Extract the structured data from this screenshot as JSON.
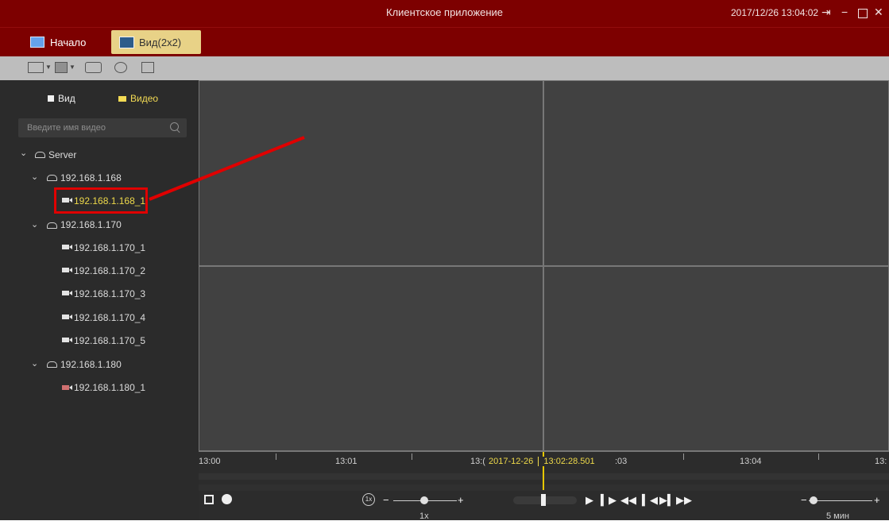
{
  "window": {
    "title": "Клиентское приложение",
    "clock": "2017/12/26 13:04:02"
  },
  "tabs": [
    {
      "label": "Начало",
      "active": false
    },
    {
      "label": "Вид(2x2)",
      "active": true
    }
  ],
  "sidebar": {
    "tabs": [
      {
        "label": "Вид",
        "active": false
      },
      {
        "label": "Видео",
        "active": true
      }
    ],
    "search": {
      "placeholder": "Введите имя видео"
    },
    "tree": {
      "root": "Server",
      "groups": [
        {
          "name": "192.168.1.168",
          "cameras": [
            "192.168.1.168_1"
          ]
        },
        {
          "name": "192.168.1.170",
          "cameras": [
            "192.168.1.170_1",
            "192.168.1.170_2",
            "192.168.1.170_3",
            "192.168.1.170_4",
            "192.168.1.170_5"
          ]
        },
        {
          "name": "192.168.1.180",
          "cameras": [
            "192.168.1.180_1"
          ]
        }
      ],
      "highlighted_camera": "192.168.1.168_1"
    }
  },
  "timeline": {
    "ticks": [
      "13:00",
      "13:01",
      "13:(",
      ":03",
      "13:04",
      "13:"
    ],
    "current_date": "2017-12-26",
    "current_time": "13:02:28.501",
    "speed_badge": "1x",
    "speed_label": "1x",
    "zoom_label": "5 мин",
    "minus": "−",
    "plus": "+"
  },
  "colors": {
    "titlebar": "#7d0000",
    "active_tab": "#e8d287",
    "highlight_text": "#eed94a",
    "annotation": "#e00000"
  }
}
